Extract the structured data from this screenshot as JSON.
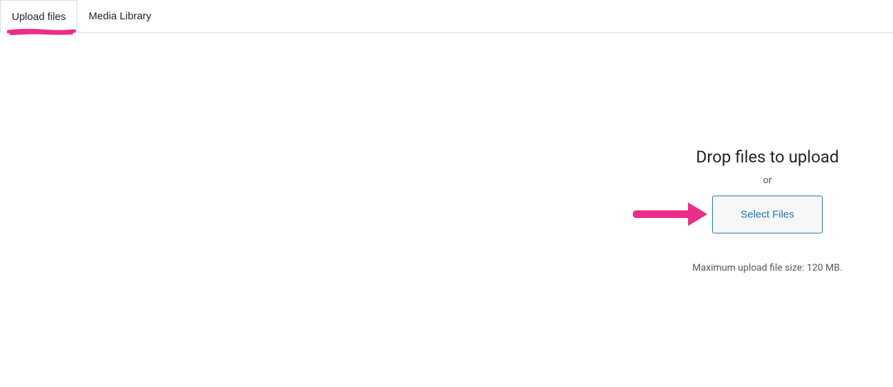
{
  "tabs": {
    "upload": "Upload files",
    "media_library": "Media Library"
  },
  "upload": {
    "drop_heading": "Drop files to upload",
    "or": "or",
    "select_button": "Select Files",
    "max_size": "Maximum upload file size: 120 MB."
  },
  "annotation": {
    "highlight_color": "#ec2e8a",
    "arrow_color": "#ec2e8a"
  }
}
